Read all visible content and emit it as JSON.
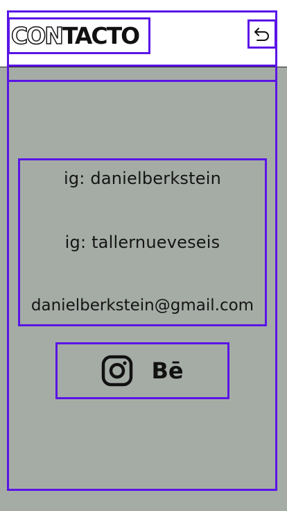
{
  "header": {
    "logo_outline": "CON",
    "logo_solid": "TACTO"
  },
  "icons": {
    "back": "back-arrow-icon",
    "instagram": "instagram-icon",
    "behance": "behance-icon"
  },
  "contact": {
    "instagram_1": "ig: danielberkstein",
    "instagram_2": "ig: tallernueveseis",
    "email": "danielberkstein@gmail.com"
  },
  "social": {
    "behance_label": "Bē"
  },
  "colors": {
    "background": "#a5aca6",
    "header": "#ffffff",
    "frame_outline": "#5a14e6",
    "text": "#111111"
  }
}
